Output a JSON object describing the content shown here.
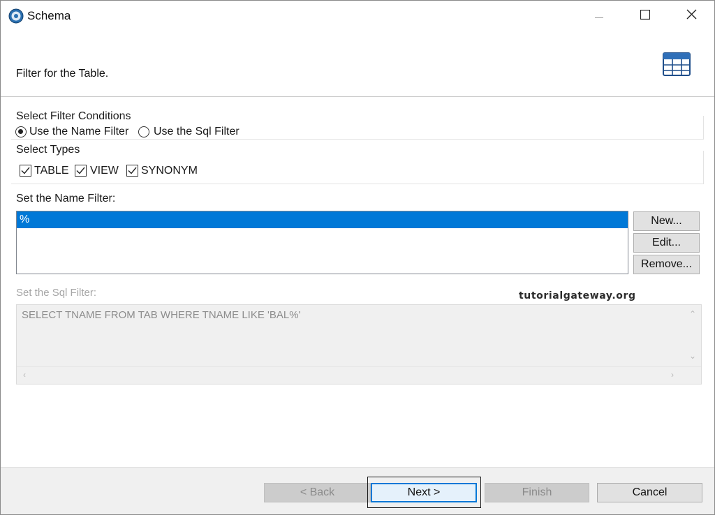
{
  "window": {
    "title": "Schema",
    "controls": {
      "minimize": "minimize-icon",
      "maximize": "maximize-icon",
      "close": "close-icon"
    }
  },
  "banner": {
    "description": "Filter for the Table.",
    "icon": "table-grid-icon"
  },
  "filter_conditions": {
    "heading": "Select Filter Conditions",
    "options": [
      {
        "label": "Use the Name Filter",
        "selected": true
      },
      {
        "label": "Use the Sql Filter",
        "selected": false
      }
    ]
  },
  "types": {
    "heading": "Select Types",
    "items": [
      {
        "label": "TABLE",
        "checked": true
      },
      {
        "label": "VIEW",
        "checked": true
      },
      {
        "label": "SYNONYM",
        "checked": true
      }
    ]
  },
  "name_filter": {
    "heading": "Set the Name Filter:",
    "items": [
      "%"
    ],
    "buttons": {
      "new": "New...",
      "edit": "Edit...",
      "remove": "Remove..."
    }
  },
  "sql_filter": {
    "heading": "Set the Sql Filter:",
    "value": "SELECT TNAME FROM TAB WHERE TNAME LIKE 'BAL%'"
  },
  "watermark": "tutorialgateway.org",
  "footer": {
    "back": "< Back",
    "next": "Next >",
    "finish": "Finish",
    "cancel": "Cancel"
  },
  "colors": {
    "selection": "#0078d7",
    "footer_bg": "#f0f0f0"
  }
}
